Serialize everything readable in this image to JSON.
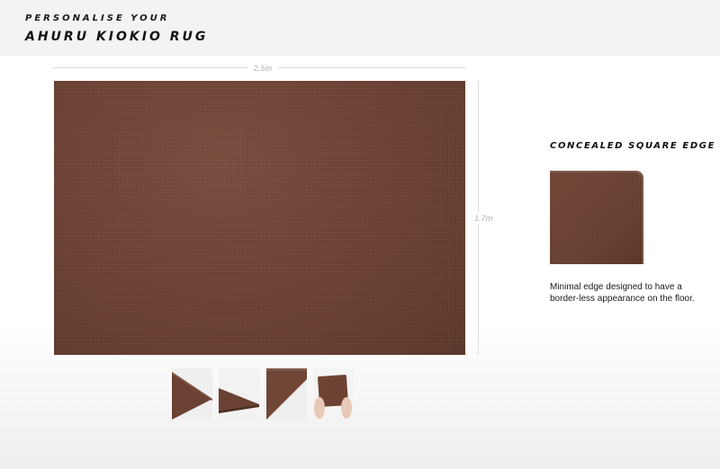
{
  "header": {
    "subtitle": "PERSONALISE YOUR",
    "title": "AHURU KIOKIO RUG"
  },
  "dimensions": {
    "width_label": "2.5m",
    "height_label": "1.7m"
  },
  "rug": {
    "color": "#6e4334"
  },
  "thumbnails": [
    {
      "icon": "rug-corner-flat-icon"
    },
    {
      "icon": "rug-corner-angle-icon"
    },
    {
      "icon": "rug-texture-closeup-icon"
    },
    {
      "icon": "rug-in-hands-icon"
    }
  ],
  "edge_option": {
    "title": "CONCEALED SQUARE EDGE",
    "description": "Minimal edge designed to have a border-less appearance on the floor."
  }
}
